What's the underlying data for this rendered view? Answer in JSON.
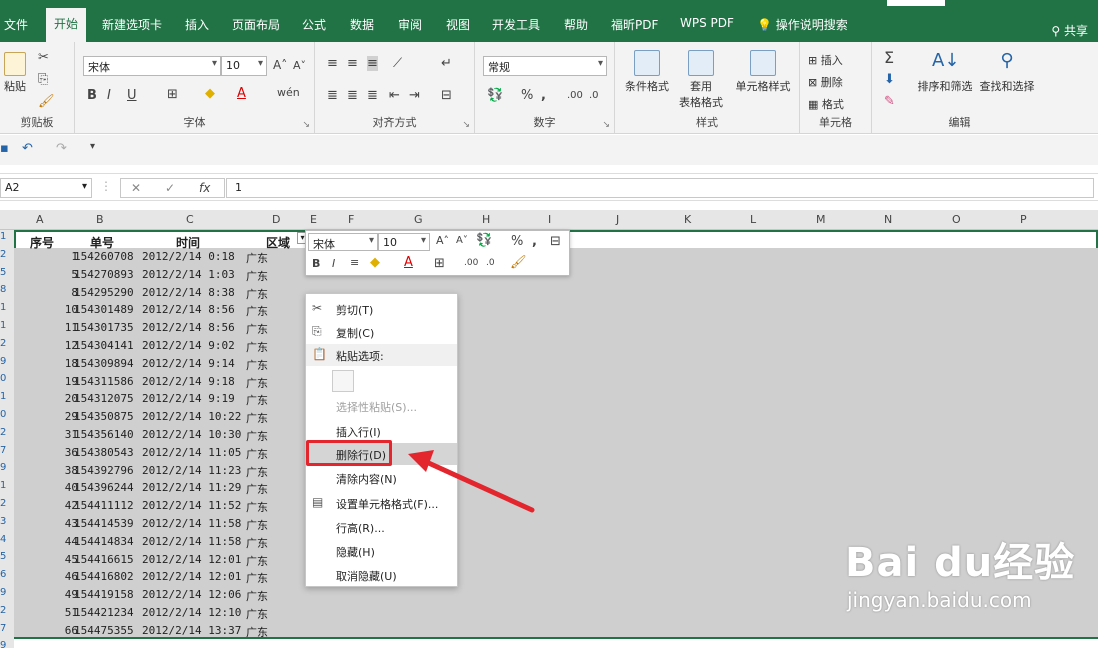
{
  "tabs": [
    "文件",
    "开始",
    "新建选项卡",
    "插入",
    "页面布局",
    "公式",
    "数据",
    "审阅",
    "视图",
    "开发工具",
    "帮助",
    "福昕PDF",
    "WPS PDF",
    "操作说明搜索"
  ],
  "share": "共享",
  "ribbon": {
    "font_name": "宋体",
    "font_size": "10",
    "number_format": "常规",
    "groups": {
      "clipboard": "剪贴板",
      "font": "字体",
      "align": "对齐方式",
      "number": "数字",
      "style": "样式",
      "cells": "单元格",
      "edit": "编辑"
    },
    "paste": "粘贴",
    "cond_format": "条件格式",
    "table_format_1": "套用",
    "table_format_2": "表格格式",
    "cell_style": "单元格样式",
    "insert": "插入",
    "delete": "删除",
    "format": "格式",
    "sort": "排序和筛选",
    "find": "查找和选择"
  },
  "namebox": "A2",
  "formula": "1",
  "columns": [
    "A",
    "B",
    "C",
    "D",
    "E",
    "F",
    "G",
    "H",
    "I",
    "J",
    "K",
    "L",
    "M",
    "N",
    "O",
    "P"
  ],
  "row_numbers": [
    "1",
    "2",
    "5",
    "8",
    "1",
    "1",
    "2",
    "9",
    "0",
    "1",
    "0",
    "2",
    "7",
    "9",
    "1",
    "2",
    "3",
    "4",
    "5",
    "6",
    "9",
    "2",
    "7",
    "9"
  ],
  "headers": [
    "序号",
    "单号",
    "时间",
    "区域"
  ],
  "rows": [
    [
      "1",
      "154260708",
      "2012/2/14 0:18",
      "广东"
    ],
    [
      "5",
      "154270893",
      "2012/2/14 1:03",
      "广东"
    ],
    [
      "8",
      "154295290",
      "2012/2/14 8:38",
      "广东"
    ],
    [
      "10",
      "154301489",
      "2012/2/14 8:56",
      "广东"
    ],
    [
      "11",
      "154301735",
      "2012/2/14 8:56",
      "广东"
    ],
    [
      "12",
      "154304141",
      "2012/2/14 9:02",
      "广东"
    ],
    [
      "18",
      "154309894",
      "2012/2/14 9:14",
      "广东"
    ],
    [
      "19",
      "154311586",
      "2012/2/14 9:18",
      "广东"
    ],
    [
      "20",
      "154312075",
      "2012/2/14 9:19",
      "广东"
    ],
    [
      "29",
      "154350875",
      "2012/2/14 10:22",
      "广东"
    ],
    [
      "31",
      "154356140",
      "2012/2/14 10:30",
      "广东"
    ],
    [
      "36",
      "154380543",
      "2012/2/14 11:05",
      "广东"
    ],
    [
      "38",
      "154392796",
      "2012/2/14 11:23",
      "广东"
    ],
    [
      "40",
      "154396244",
      "2012/2/14 11:29",
      "广东"
    ],
    [
      "42",
      "154411112",
      "2012/2/14 11:52",
      "广东"
    ],
    [
      "43",
      "154414539",
      "2012/2/14 11:58",
      "广东"
    ],
    [
      "44",
      "154414834",
      "2012/2/14 11:58",
      "广东"
    ],
    [
      "45",
      "154416615",
      "2012/2/14 12:01",
      "广东"
    ],
    [
      "46",
      "154416802",
      "2012/2/14 12:01",
      "广东"
    ],
    [
      "49",
      "154419158",
      "2012/2/14 12:06",
      "广东"
    ],
    [
      "51",
      "154421234",
      "2012/2/14 12:10",
      "广东"
    ],
    [
      "66",
      "154475355",
      "2012/2/14 13:37",
      "广东"
    ]
  ],
  "mini": {
    "font": "宋体",
    "size": "10"
  },
  "context_menu": {
    "cut": "剪切(T)",
    "copy": "复制(C)",
    "paste_opts": "粘贴选项:",
    "paste_special": "选择性粘贴(S)...",
    "insert_row": "插入行(I)",
    "delete_row": "删除行(D)",
    "clear": "清除内容(N)",
    "format_cells": "设置单元格格式(F)...",
    "row_height": "行高(R)...",
    "hide": "隐藏(H)",
    "unhide": "取消隐藏(U)"
  },
  "watermark": {
    "brand": "Bai du经验",
    "url": "jingyan.baidu.com"
  },
  "colors": {
    "excel_green": "#217346",
    "highlight_red": "#e3262e"
  }
}
